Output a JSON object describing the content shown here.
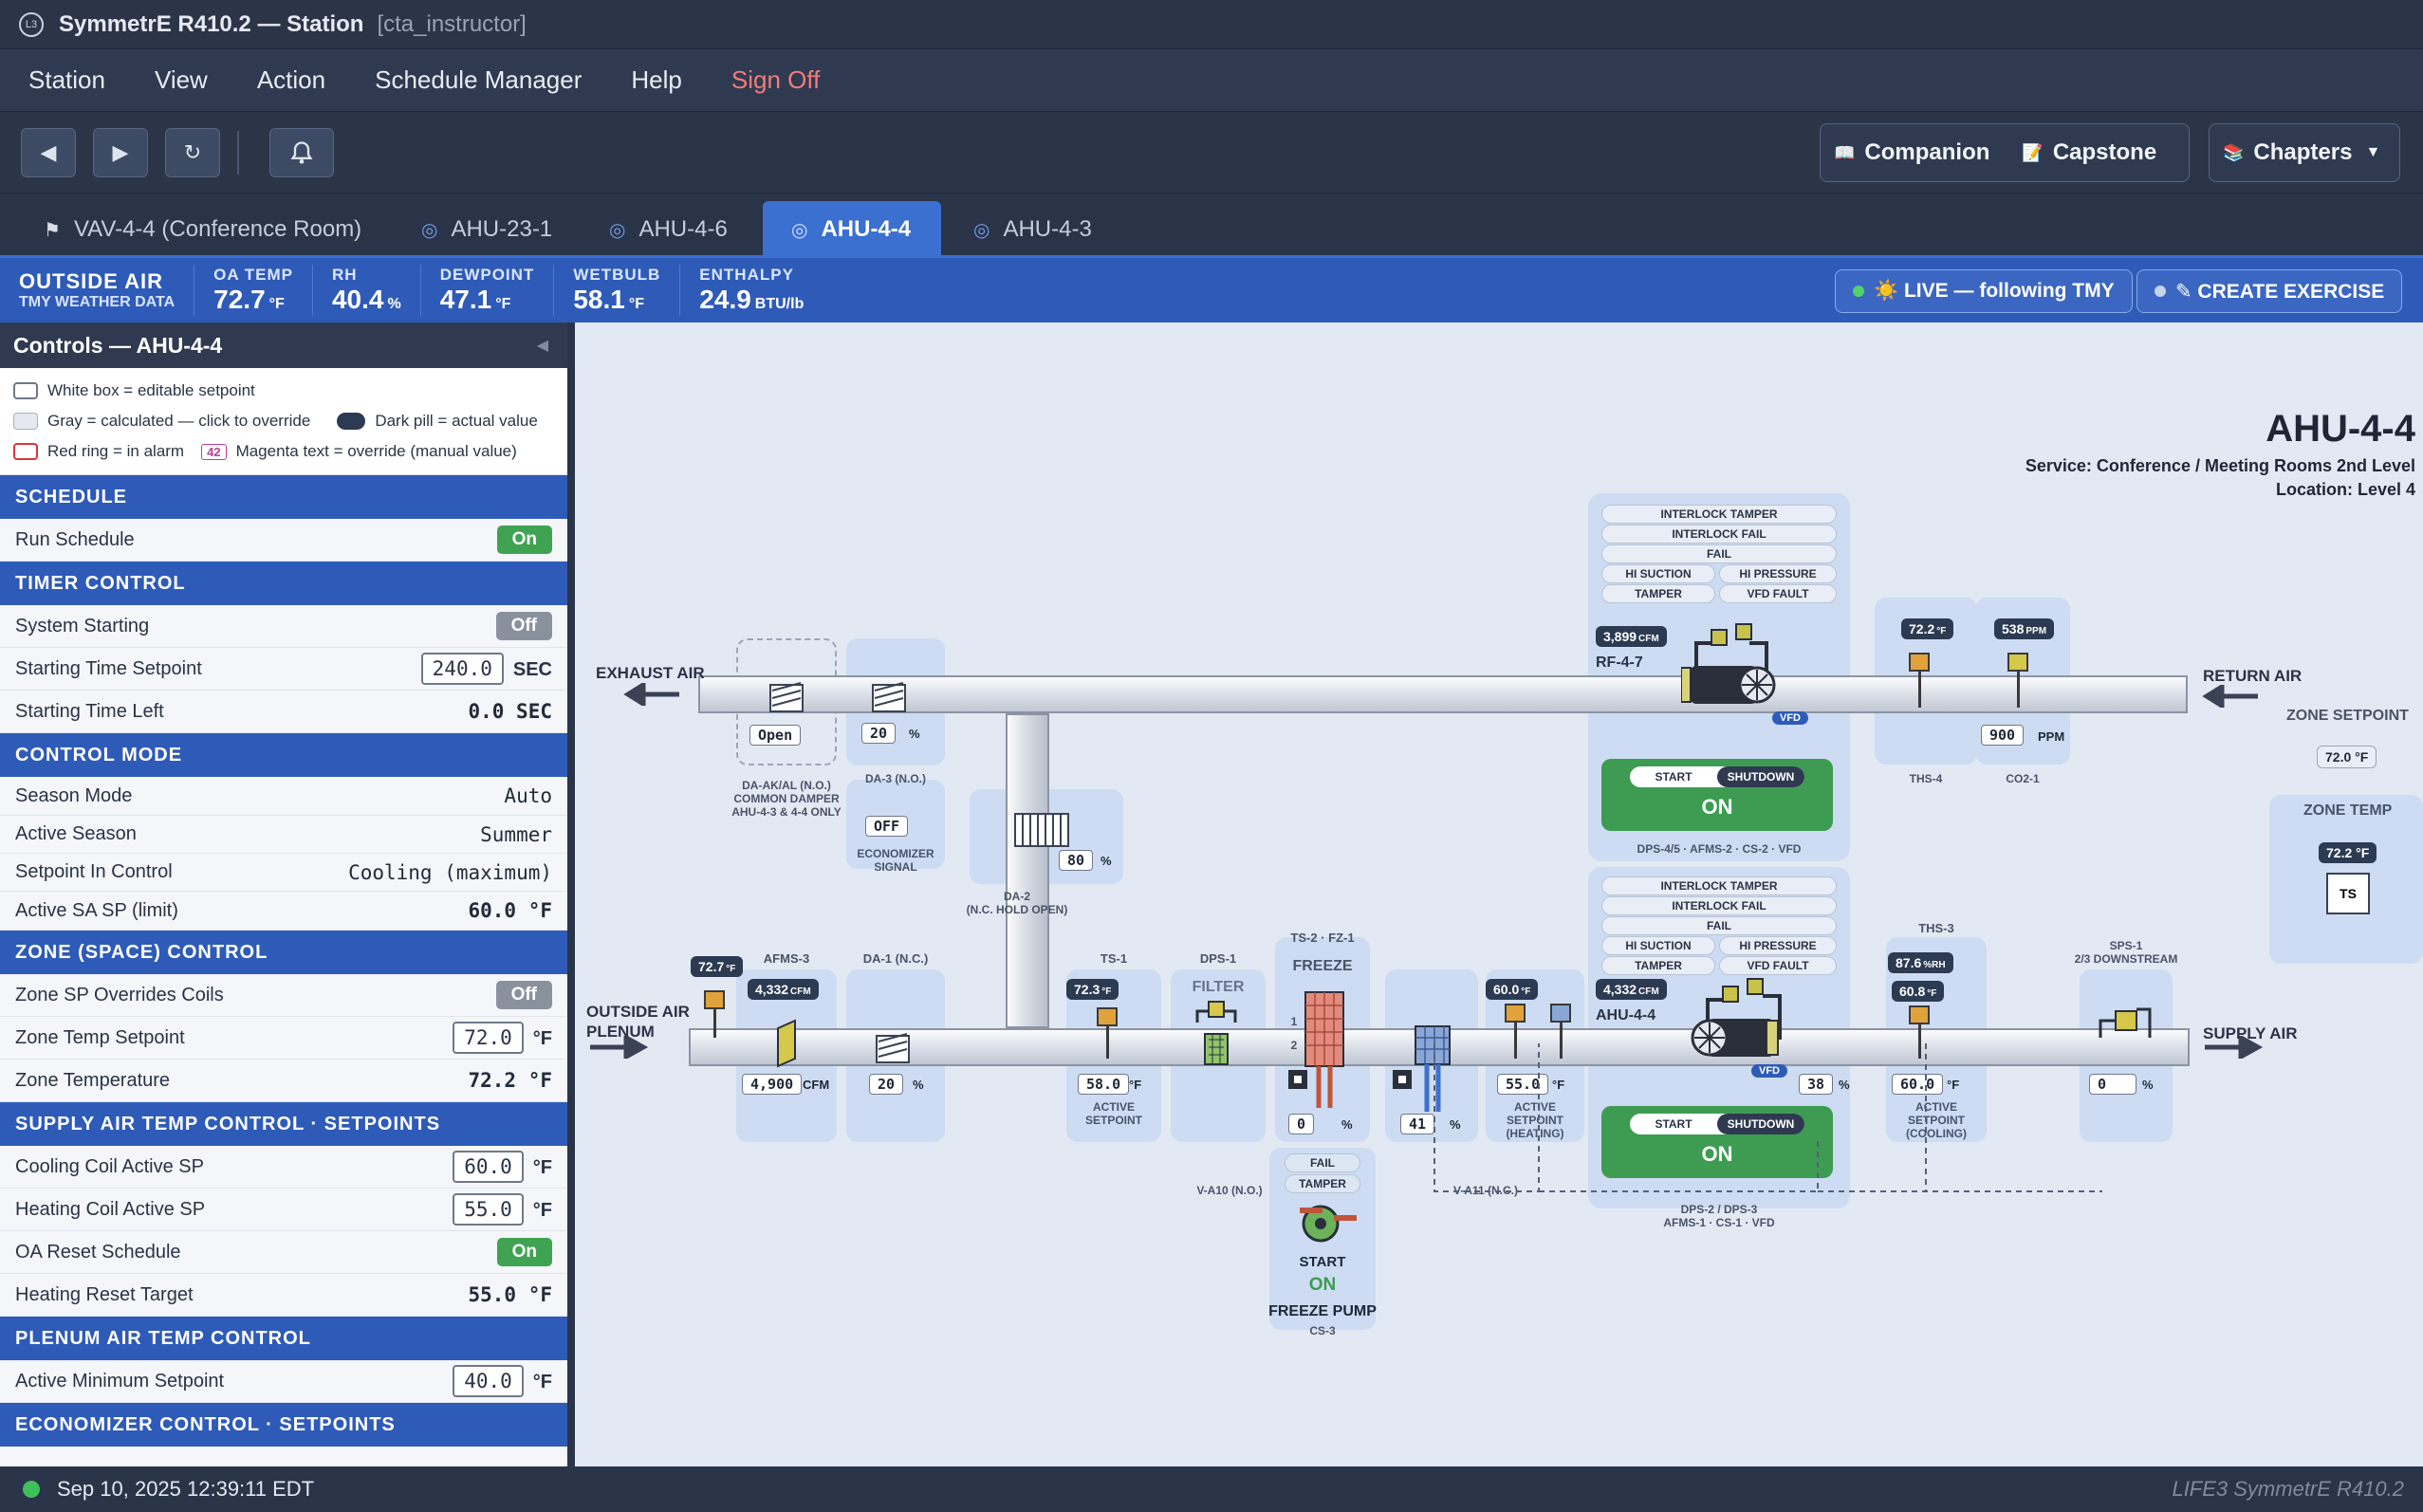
{
  "window": {
    "title": "SymmetrE R410.2 — Station",
    "role": "[cta_instructor]",
    "logo": "L3"
  },
  "menu": [
    "Station",
    "View",
    "Action",
    "Schedule Manager",
    "Help",
    "Sign Off"
  ],
  "toolbar": {
    "companion": "Companion",
    "capstone": "Capstone",
    "chapters": "Chapters"
  },
  "tabs": [
    {
      "label": "VAV-4-4 (Conference Room)",
      "icon": "fan-icon"
    },
    {
      "label": "AHU-23-1",
      "icon": "spiral-icon"
    },
    {
      "label": "AHU-4-6",
      "icon": "spiral-icon"
    },
    {
      "label": "AHU-4-4",
      "icon": "spiral-icon",
      "active": true
    },
    {
      "label": "AHU-4-3",
      "icon": "spiral-icon"
    }
  ],
  "outside_air": {
    "title": "OUTSIDE AIR",
    "subtitle": "TMY WEATHER DATA",
    "oa_temp": {
      "label": "OA TEMP",
      "value": "72.7",
      "unit": "°F"
    },
    "rh": {
      "label": "RH",
      "value": "40.4",
      "unit": "%"
    },
    "dewpoint": {
      "label": "DEWPOINT",
      "value": "47.1",
      "unit": "°F"
    },
    "wetbulb": {
      "label": "WETBULB",
      "value": "58.1",
      "unit": "°F"
    },
    "enthalpy": {
      "label": "ENTHALPY",
      "value": "24.9",
      "unit": "BTU/lb"
    },
    "live": "☀️ LIVE — following TMY",
    "create": "✎ CREATE EXERCISE"
  },
  "controls": {
    "title": "Controls — AHU-4-4",
    "legend": {
      "white": "White box = editable setpoint",
      "gray": "Gray = calculated — click to override",
      "dark": "Dark pill = actual value",
      "red": "Red ring = in alarm",
      "magenta_sample": "42",
      "magenta": "Magenta text = override (manual value)"
    },
    "sections": {
      "schedule": "SCHEDULE",
      "timer": "TIMER CONTROL",
      "mode": "CONTROL MODE",
      "zone": "ZONE (SPACE) CONTROL",
      "supply": "SUPPLY AIR TEMP CONTROL · SETPOINTS",
      "plenum": "PLENUM AIR TEMP CONTROL",
      "economizer": "ECONOMIZER CONTROL · SETPOINTS"
    },
    "run_schedule": {
      "label": "Run Schedule",
      "value": "On"
    },
    "system_starting": {
      "label": "System Starting",
      "value": "Off"
    },
    "starting_time_sp": {
      "label": "Starting Time Setpoint",
      "value": "240.0",
      "unit": "SEC"
    },
    "starting_time_left": {
      "label": "Starting Time Left",
      "value": "0.0 SEC"
    },
    "season_mode": {
      "label": "Season Mode",
      "value": "Auto"
    },
    "active_season": {
      "label": "Active Season",
      "value": "Summer"
    },
    "sp_in_control": {
      "label": "Setpoint In Control",
      "value": "Cooling (maximum)"
    },
    "active_sa_sp": {
      "label": "Active SA SP (limit)",
      "value": "60.0 °F"
    },
    "zone_sp_override": {
      "label": "Zone SP Overrides Coils",
      "value": "Off"
    },
    "zone_temp_sp": {
      "label": "Zone Temp Setpoint",
      "value": "72.0",
      "unit": "°F"
    },
    "zone_temp": {
      "label": "Zone Temperature",
      "value": "72.2 °F"
    },
    "cooling_sp": {
      "label": "Cooling Coil Active SP",
      "value": "60.0",
      "unit": "°F"
    },
    "heating_sp": {
      "label": "Heating Coil Active SP",
      "value": "55.0",
      "unit": "°F"
    },
    "oa_reset": {
      "label": "OA Reset Schedule",
      "value": "On"
    },
    "heating_reset": {
      "label": "Heating Reset Target",
      "value": "55.0 °F"
    },
    "active_min_sp": {
      "label": "Active Minimum Setpoint",
      "value": "40.0",
      "unit": "°F"
    }
  },
  "diagram": {
    "title": "AHU-4-4",
    "service": "Service: Conference / Meeting Rooms 2nd Level",
    "location": "Location: Level 4",
    "exhaust_air": "EXHAUST AIR",
    "return_air": "RETURN AIR",
    "outside_air_plenum": [
      "OUTSIDE AIR",
      "PLENUM"
    ],
    "supply_air": "SUPPLY AIR",
    "zone_setpoint": "ZONE SETPOINT",
    "zone_setpoint_value": "72.0 °F",
    "zone_temp": "ZONE TEMP",
    "zone_temp_value": "72.2 °F",
    "ts": "TS",
    "da_ak": {
      "state": "Open",
      "label": [
        "DA-AK/AL (N.O.)",
        "COMMON DAMPER",
        "AHU-4-3 & 4-4 ONLY"
      ]
    },
    "da3": {
      "value": "20",
      "unit": "%",
      "label": "DA-3 (N.O.)"
    },
    "econ": {
      "value": "OFF",
      "label": [
        "ECONOMIZER",
        "SIGNAL"
      ]
    },
    "da2": {
      "value": "80",
      "unit": "%",
      "label": [
        "DA-2",
        "(N.C. HOLD OPEN)"
      ]
    },
    "rf": {
      "cfm": "3,899",
      "cfm_unit": "CFM",
      "label": "RF-4-7",
      "vfd": "VFD"
    },
    "return_alarms": [
      "INTERLOCK TAMPER",
      "INTERLOCK FAIL",
      "FAIL",
      "HI SUCTION",
      "HI PRESSURE",
      "TAMPER",
      "VFD FAULT"
    ],
    "return_start": {
      "start": "START",
      "shutdown": "SHUTDOWN",
      "state": "ON",
      "label": "DPS-4/5 · AFMS-2 · CS-2 · VFD"
    },
    "ths4": {
      "value": "72.2",
      "unit": "°F",
      "label": "THS-4"
    },
    "co2": {
      "value": "538",
      "unit": "PPM",
      "sp": "900",
      "sp_unit": "PPM",
      "label": "CO2-1"
    },
    "oa_temp": {
      "value": "72.7",
      "unit": "°F"
    },
    "afms3": {
      "label": "AFMS-3",
      "cfm": "4,332",
      "cfm_unit": "CFM",
      "sp": "4,900",
      "sp_unit": "CFM"
    },
    "da1": {
      "label": "DA-1 (N.C.)",
      "value": "20",
      "unit": "%"
    },
    "ts1": {
      "label": "TS-1",
      "value": "72.3",
      "unit": "°F",
      "sp": "58.0",
      "sp_unit": "°F",
      "sp_label": [
        "ACTIVE",
        "SETPOINT"
      ]
    },
    "dps1": {
      "label": "DPS-1",
      "filter": "FILTER"
    },
    "freeze": {
      "label": "TS-2 · FZ-1",
      "title": "FREEZE",
      "rows": [
        "1",
        "2"
      ],
      "valve": "0",
      "valve_unit": "%",
      "valve_label": "V-A10 (N.O.)"
    },
    "pump": {
      "alarms": [
        "FAIL",
        "TAMPER"
      ],
      "start": "START",
      "state": "ON",
      "label": "FREEZE PUMP",
      "cs": "CS-3"
    },
    "v11": {
      "value": "41",
      "unit": "%",
      "label": "V-A11 (N.C.)"
    },
    "heat": {
      "value": "60.0",
      "unit": "°F",
      "sp": "55.0",
      "sp_unit": "°F",
      "sp_label": [
        "ACTIVE",
        "SETPOINT",
        "(HEATING)"
      ]
    },
    "sf": {
      "cfm": "4,332",
      "cfm_unit": "CFM",
      "label": "AHU-4-4",
      "vfd": "VFD",
      "speed": "38",
      "speed_unit": "%"
    },
    "supply_alarms": [
      "INTERLOCK TAMPER",
      "INTERLOCK FAIL",
      "FAIL",
      "HI SUCTION",
      "HI PRESSURE",
      "TAMPER",
      "VFD FAULT"
    ],
    "supply_start": {
      "start": "START",
      "shutdown": "SHUTDOWN",
      "state": "ON",
      "label": [
        "DPS-2 / DPS-3",
        "AFMS-1 · CS-1 · VFD"
      ]
    },
    "ths3": {
      "label": "THS-3",
      "rh": "87.6",
      "rh_unit": "%RH",
      "temp": "60.8",
      "temp_unit": "°F",
      "sp": "60.0",
      "sp_unit": "°F",
      "sp_label": [
        "ACTIVE",
        "SETPOINT",
        "(COOLING)"
      ]
    },
    "sps1": {
      "label": [
        "SPS-1",
        "2/3 DOWNSTREAM"
      ],
      "value": "0",
      "unit": "%"
    }
  },
  "status": {
    "datetime": "Sep 10, 2025 12:39:11 EDT",
    "brand": "LIFE3 SymmetrE R410.2"
  },
  "colors": {
    "accent": "#2f5bb8",
    "on": "#3d9c52",
    "dark": "#2a3448"
  }
}
